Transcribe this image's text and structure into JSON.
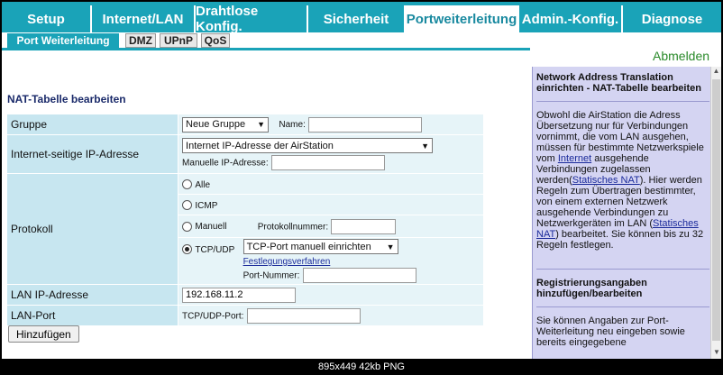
{
  "nav": {
    "tabs": [
      {
        "label": "Setup"
      },
      {
        "label": "Internet/LAN"
      },
      {
        "label": "Drahtlose Konfig."
      },
      {
        "label": "Sicherheit"
      },
      {
        "label": "Portweiterleitung"
      },
      {
        "label": "Admin.-Konfig."
      },
      {
        "label": "Diagnose"
      }
    ],
    "active_index": 4
  },
  "subnav": {
    "items": [
      {
        "label": "Port Weiterleitung"
      },
      {
        "label": "DMZ"
      },
      {
        "label": "UPnP"
      },
      {
        "label": "QoS"
      }
    ]
  },
  "logout": "Abmelden",
  "form": {
    "heading": "NAT-Tabelle bearbeiten",
    "group": {
      "label": "Gruppe",
      "select": "Neue Gruppe",
      "name_label": "Name:",
      "name_value": ""
    },
    "ip": {
      "label": "Internet-seitige IP-Adresse",
      "select": "Internet IP-Adresse der AirStation",
      "manual_label": "Manuelle IP-Adresse:",
      "manual_value": ""
    },
    "protocol": {
      "label": "Protokoll",
      "opt_all": "Alle",
      "opt_icmp": "ICMP",
      "opt_manual": "Manuell",
      "protocol_number_label": "Protokollnummer:",
      "opt_tcpudp": "TCP/UDP",
      "tcpudp_select": "TCP-Port manuell einrichten",
      "procedure_link": "Festlegungsverfahren",
      "port_number_label": "Port-Nummer:"
    },
    "lan_ip": {
      "label": "LAN IP-Adresse",
      "value": "192.168.11.2"
    },
    "lan_port": {
      "label": "LAN-Port",
      "tcpudp_port_label": "TCP/UDP-Port:",
      "value": ""
    },
    "add_button": "Hinzufügen"
  },
  "help": {
    "title1": "Network Address Translation einrichten - NAT-Tabelle bearbeiten",
    "body_a": "Obwohl die AirStation die Adress Übersetzung nur für Verbindungen vornimmt, die vom LAN ausgehen, müssen für bestimmte Netzwerkspiele vom ",
    "link_internet": "Internet",
    "body_b": " ausgehende Verbindungen zugelassen werden(",
    "link_static1": "Statisches NAT",
    "body_c": "). Hier werden Regeln zum Übertragen bestimmter, von einem externen Netzwerk ausgehende Verbindungen zu Netzwerkgeräten im LAN (",
    "link_static2": "Statisches NAT",
    "body_d": ") bearbeitet. Sie können bis zu 32 Regeln festlegen.",
    "title2": "Registrierungsangaben hinzufügen/bearbeiten",
    "body2": "Sie können Angaben zur Port-Weiterleitung neu eingeben sowie bereits eingegebene"
  },
  "image_info": "895x449  42kb  PNG"
}
